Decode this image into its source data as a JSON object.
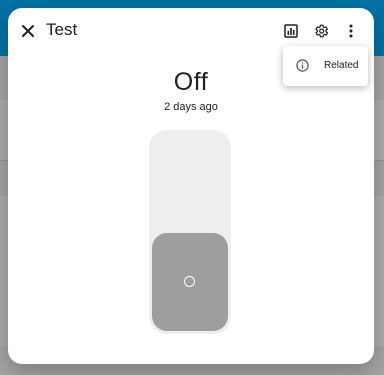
{
  "dialog": {
    "title": "Test",
    "state": "Off",
    "last_changed": "2 days ago"
  },
  "toolbar": {
    "close_icon": "close-icon",
    "history_icon": "chart-bar-icon",
    "settings_icon": "gear-icon",
    "more_icon": "more-vert-icon"
  },
  "switch": {
    "state": "off"
  },
  "menu": {
    "items": [
      {
        "label": "Related",
        "icon": "info-icon"
      }
    ]
  },
  "colors": {
    "header_accent": "#03a9f4",
    "switch_track": "#eeeeee",
    "switch_knob": "#9e9e9e",
    "text": "#212121"
  }
}
